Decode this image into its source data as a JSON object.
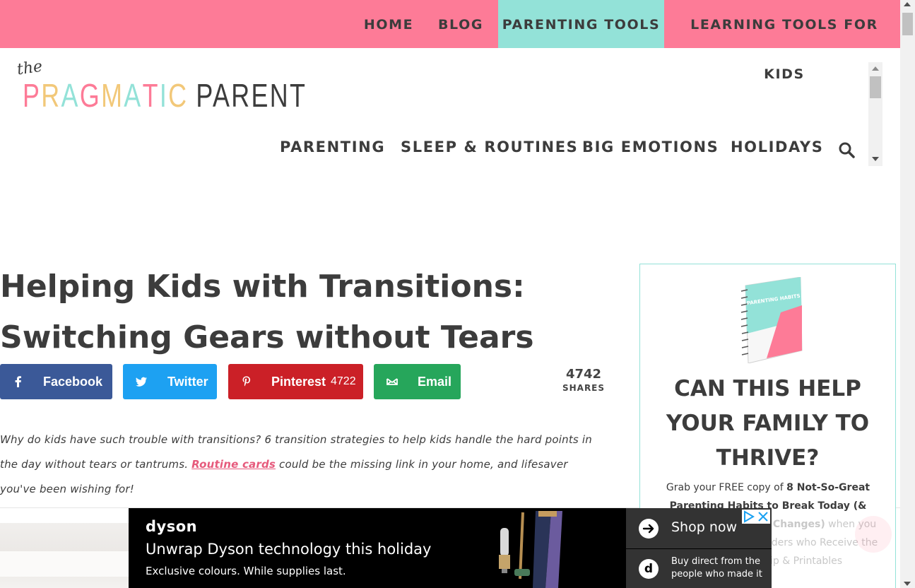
{
  "top_nav": {
    "items": [
      "HOME",
      "BLOG",
      "PARENTING TOOLS",
      "LEARNING TOOLS FOR KIDS"
    ],
    "active": "PARENTING TOOLS"
  },
  "logo": {
    "the": "the",
    "letters": [
      "P",
      "R",
      "A",
      "G",
      "M",
      "A",
      "T",
      "I",
      "C"
    ],
    "letter_colors": [
      "#fd7b97",
      "#f2c879",
      "#93e2d8",
      "#fd7b97",
      "#f2c879",
      "#93e2d8",
      "#fd7b97",
      "#93e2d8",
      "#f2c879"
    ],
    "second_word": "PARENT"
  },
  "main_nav": {
    "items": [
      "PARENTING",
      "SLEEP & ROUTINES",
      "BIG EMOTIONS",
      "HOLIDAYS"
    ],
    "search_icon": "search-icon"
  },
  "article": {
    "title_line1": "Helping Kids with Transitions:",
    "title_line2": "Switching Gears without Tears",
    "share": {
      "facebook": "Facebook",
      "twitter": "Twitter",
      "pinterest": "Pinterest",
      "pinterest_count": "4722",
      "email": "Email",
      "total": "4742",
      "total_label": "SHARES"
    },
    "intro_before": "Why do kids have such trouble with transitions? 6 transition strategies to help kids handle the hard points in the day without tears or tantrums. ",
    "intro_link": "Routine cards",
    "intro_after": " could be the missing link in your home, and lifesaver you've been wishing for!"
  },
  "sidebar": {
    "book_title": "PARENTING HABITS",
    "heading": "CAN THIS HELP YOUR FAMILY TO THRIVE?",
    "text_before": "Grab your FREE copy of ",
    "text_bold": "8 Not-So-Great Parenting Habits to Break Today (&",
    "text_bold2": "Changes)",
    "text_after": " when you",
    "text_line4": "ders who Receive the",
    "text_line5": "Tip & Printables"
  },
  "ad": {
    "brand": "dyson",
    "headline": "Unwrap Dyson technology this holiday",
    "sub": "Exclusive colours. While supplies last.",
    "cta": "Shop now",
    "cta2": "Buy direct from the people who made it",
    "d_letter": "d"
  },
  "colors": {
    "pink": "#fd7b97",
    "teal": "#93e2d8",
    "facebook": "#3b5998",
    "twitter": "#1da1f2",
    "pinterest": "#cb2027",
    "email": "#26a65b"
  }
}
